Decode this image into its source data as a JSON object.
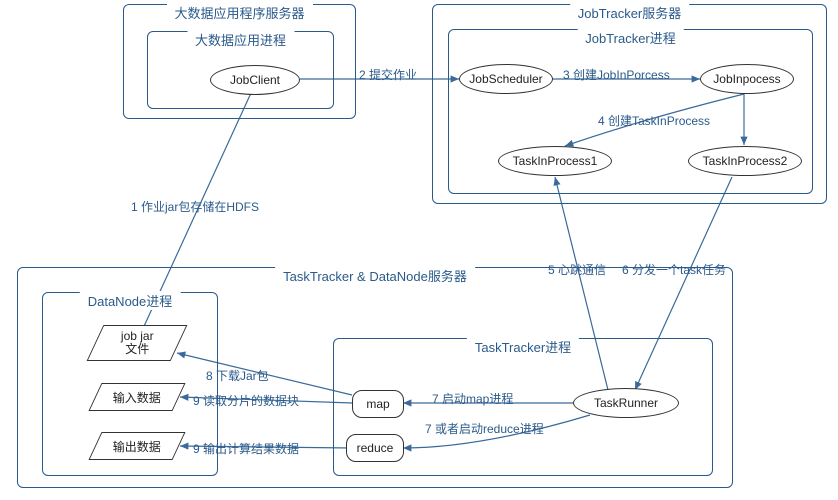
{
  "servers": {
    "app": {
      "title": "大数据应用程序服务器"
    },
    "jobtracker": {
      "title": "JobTracker服务器"
    },
    "tasktracker": {
      "title": "TaskTracker & DataNode服务器"
    }
  },
  "processes": {
    "appProcess": {
      "title": "大数据应用进程"
    },
    "jobTrackerProcess": {
      "title": "JobTracker进程"
    },
    "dataNodeProcess": {
      "title": "DataNode进程"
    },
    "taskTrackerProcess": {
      "title": "TaskTracker进程"
    }
  },
  "nodes": {
    "jobClient": "JobClient",
    "jobScheduler": "JobScheduler",
    "jobInProcess": "JobInpocess",
    "taskInProcess1": "TaskInProcess1",
    "taskInProcess2": "TaskInProcess2",
    "jobJar": "job jar\n文件",
    "inputData": "输入数据",
    "outputData": "输出数据",
    "map": "map",
    "reduce": "reduce",
    "taskRunner": "TaskRunner"
  },
  "edges": {
    "e1": "1 作业jar包存储在HDFS",
    "e2": "2 提交作业",
    "e3": "3 创建JobInPorcess",
    "e4": "4 创建TaskInProcess",
    "e5": "5 心跳通信",
    "e6": "6 分发一个task任务",
    "e7a": "7 启动map进程",
    "e7b": "7 或者启动reduce进程",
    "e8": "8 下载Jar包",
    "e9a": "9 读取分片的数据块",
    "e9b": "9 输出计算结果数据"
  },
  "colors": {
    "border": "#2a5a8a",
    "text": "#2a5a8a",
    "arrow": "#3a6a9a"
  }
}
